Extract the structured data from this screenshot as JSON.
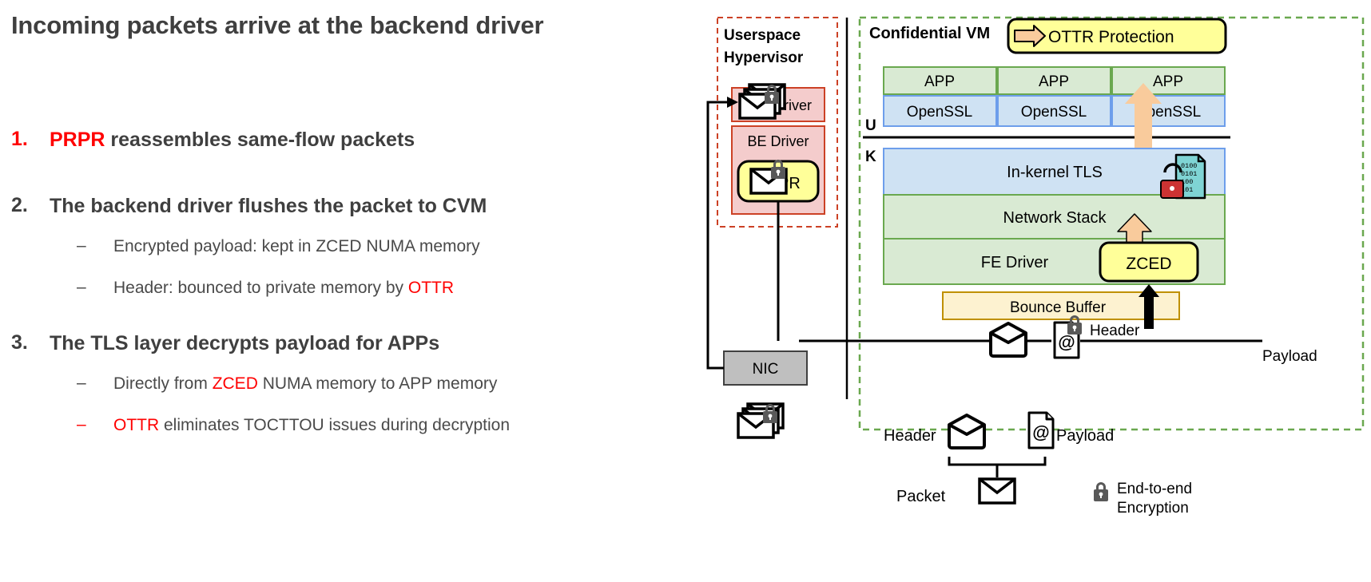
{
  "slide": {
    "title": "Incoming packets arrive at the backend driver"
  },
  "bullets": [
    {
      "num": "1.",
      "pre": "",
      "highlight": "PRPR",
      "post": " reassembles same-flow packets",
      "sub": []
    },
    {
      "num": "2.",
      "pre": "The backend driver flushes the packet to CVM",
      "highlight": "",
      "post": "",
      "sub": [
        {
          "dash": "–",
          "pre": "Encrypted payload: kept in ZCED NUMA memory",
          "highlight": "",
          "post": "",
          "dash_red": false
        },
        {
          "dash": "–",
          "pre": "Header: bounced to private memory by ",
          "highlight": "OTTR",
          "post": "",
          "dash_red": false
        }
      ]
    },
    {
      "num": "3.",
      "pre": "The TLS layer decrypts payload for APPs",
      "highlight": "",
      "post": "",
      "sub": [
        {
          "dash": "–",
          "pre": "Directly from ",
          "highlight": "ZCED",
          "post": " NUMA memory to APP memory",
          "dash_red": false
        },
        {
          "dash": "–",
          "pre": "",
          "highlight": "OTTR",
          "post": " eliminates TOCTTOU issues during decryption",
          "dash_red": true
        }
      ]
    }
  ],
  "diagram": {
    "hypervisor": {
      "title_line1": "Userspace",
      "title_line2": "Hypervisor",
      "nic_driver": "NIC Driver",
      "be_driver": "BE Driver",
      "prpr": "PRPR"
    },
    "cvm": {
      "title": "Confidential VM",
      "legend_badge": "OTTR Protection",
      "user_mark": "U",
      "kernel_mark": "K",
      "apps": [
        "APP",
        "APP",
        "APP"
      ],
      "ssl": [
        "OpenSSL",
        "OpenSSL",
        "OpenSSL"
      ],
      "kernel_layers": [
        "In-kernel TLS",
        "Network Stack",
        "FE Driver"
      ],
      "zced": "ZCED",
      "bounce_buffer": "Bounce Buffer",
      "header_label": "Header",
      "payload_label": "Payload",
      "payload_glyph": "@"
    },
    "nic": "NIC",
    "legend": {
      "header": "Header",
      "payload": "Payload",
      "payload_glyph": "@",
      "packet": "Packet",
      "encryption_line1": "End-to-end",
      "encryption_line2": "Encryption"
    }
  },
  "colors": {
    "red_accent": "#ff0000",
    "hypervisor_fill": "#f4cccc",
    "hypervisor_border": "#cc4125",
    "cvm_border": "#6aa84f",
    "app_fill": "#d9ead3",
    "app_border": "#6aa84f",
    "ssl_fill": "#cfe2f3",
    "ssl_border": "#6d9eeb",
    "tls_fill": "#cfe2f3",
    "netstack_fill": "#d9ead3",
    "zced_fill": "#ffff99",
    "bounce_fill": "#fdf2d0",
    "bounce_border": "#bf9000",
    "arrow_fill": "#f9cb9c",
    "arrow_stroke": "#000000",
    "nic_fill": "#bfbfbf",
    "lock_dark": "#595959",
    "lock_red": "#cc3333",
    "doc_teal": "#7fd4d4",
    "title_gray": "#3f3f3f"
  }
}
